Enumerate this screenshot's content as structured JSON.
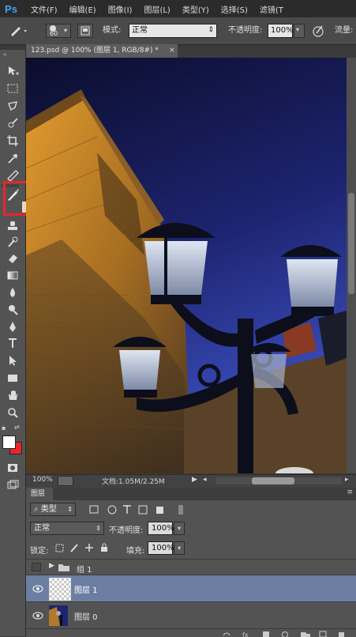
{
  "app": {
    "logo": "Ps"
  },
  "menu": [
    "文件(F)",
    "编辑(E)",
    "图像(I)",
    "图层(L)",
    "类型(Y)",
    "选择(S)",
    "滤镜(T"
  ],
  "options": {
    "brush_size": "60",
    "mode_label": "模式:",
    "mode_value": "正常",
    "opacity_label": "不透明度:",
    "opacity_value": "100%",
    "flow_label": "流量:"
  },
  "document": {
    "tab_title": "123.psd @ 100% (图层 1, RGB/8#) *",
    "tab_close": "×"
  },
  "status": {
    "zoom": "100%",
    "doc_info": "文档:1.05M/2.25M"
  },
  "layers_panel": {
    "title": "图层",
    "filter_label": "类型",
    "blend_mode": "正常",
    "opacity_label": "不透明度:",
    "opacity_value": "100%",
    "lock_label": "锁定:",
    "fill_label": "填充:",
    "fill_value": "100%",
    "layers": [
      {
        "name": "组 1",
        "type": "group",
        "visible": false,
        "selected": false
      },
      {
        "name": "图层 1",
        "type": "layer",
        "visible": true,
        "selected": true
      },
      {
        "name": "图层 0",
        "type": "image",
        "visible": true,
        "selected": false
      }
    ]
  },
  "colors": {
    "accent_highlight": "#e8262a",
    "selected_layer": "#6c7fa3",
    "sky_top": "#0b0d2c",
    "sky_bottom": "#3c4fc0"
  },
  "icons": [
    "move-icon",
    "marquee-icon",
    "lasso-icon",
    "quick-select-icon",
    "crop-icon",
    "eyedropper-icon",
    "healing-icon",
    "brush-icon",
    "clone-stamp-icon",
    "history-brush-icon",
    "eraser-icon",
    "gradient-icon",
    "blur-icon",
    "dodge-icon",
    "pen-icon",
    "type-icon",
    "path-select-icon",
    "shape-icon",
    "hand-icon",
    "zoom-icon"
  ]
}
